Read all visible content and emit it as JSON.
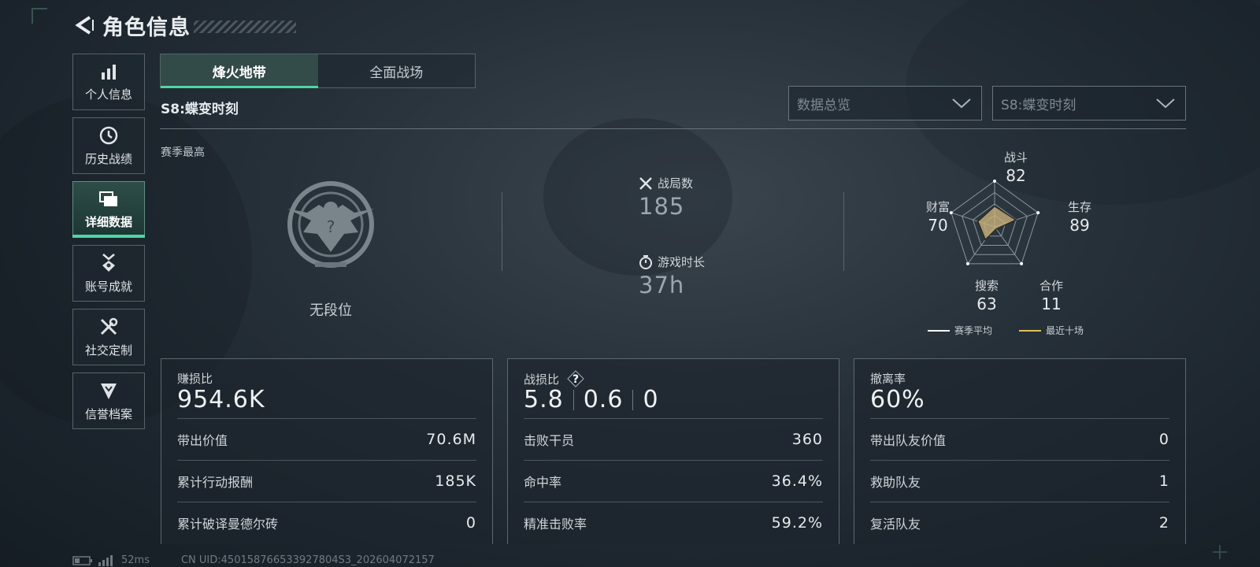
{
  "header": {
    "title": "角色信息"
  },
  "sidebar": {
    "items": [
      {
        "label": "个人信息",
        "icon": "bar-chart-icon",
        "active": false
      },
      {
        "label": "历史战绩",
        "icon": "history-clock-icon",
        "active": false
      },
      {
        "label": "详细数据",
        "icon": "folders-icon",
        "active": true
      },
      {
        "label": "账号成就",
        "icon": "medal-icon",
        "active": false
      },
      {
        "label": "社交定制",
        "icon": "tools-icon",
        "active": false
      },
      {
        "label": "信誉档案",
        "icon": "shield-badge-icon",
        "active": false
      }
    ]
  },
  "tabs": [
    {
      "label": "烽火地带",
      "active": true
    },
    {
      "label": "全面战场",
      "active": false
    }
  ],
  "season": {
    "title": "S8:蝶变时刻"
  },
  "filters": {
    "overview": "数据总览",
    "season": "S8:蝶变时刻"
  },
  "highlights": {
    "section_label": "赛季最高",
    "rank_text": "无段位",
    "matches_label": "战局数",
    "matches_value": "185",
    "playtime_label": "游戏时长",
    "playtime_value": "37h"
  },
  "radar": {
    "axes": [
      {
        "label": "战斗",
        "value": "82"
      },
      {
        "label": "生存",
        "value": "89"
      },
      {
        "label": "合作",
        "value": "11"
      },
      {
        "label": "搜索",
        "value": "63"
      },
      {
        "label": "财富",
        "value": "70"
      }
    ],
    "legend": {
      "season_avg": "赛季平均",
      "recent_ten": "最近十场"
    },
    "colors": {
      "season_avg": "#ffffff",
      "recent_ten": "#e3c15a",
      "fill": "#c9b27a"
    }
  },
  "cards": {
    "profit": {
      "title": "赚损比",
      "big": "954.6K",
      "rows": [
        {
          "k": "带出价值",
          "v": "70.6M"
        },
        {
          "k": "累计行动报酬",
          "v": "185K"
        },
        {
          "k": "累计破译曼德尔砖",
          "v": "0"
        }
      ]
    },
    "combat": {
      "title": "战损比",
      "big_a": "5.8",
      "big_b": "0.6",
      "big_c": "0",
      "rows": [
        {
          "k": "击败干员",
          "v": "360"
        },
        {
          "k": "命中率",
          "v": "36.4%"
        },
        {
          "k": "精准击败率",
          "v": "59.2%"
        }
      ]
    },
    "extract": {
      "title": "撤离率",
      "big": "60%",
      "rows": [
        {
          "k": "带出队友价值",
          "v": "0"
        },
        {
          "k": "救助队友",
          "v": "1"
        },
        {
          "k": "复活队友",
          "v": "2"
        }
      ]
    }
  },
  "footer": {
    "ping": "52ms",
    "uid": "CN UID:450158766533927804S3_202604072157"
  },
  "colors": {
    "accent": "#4fd6a4"
  }
}
